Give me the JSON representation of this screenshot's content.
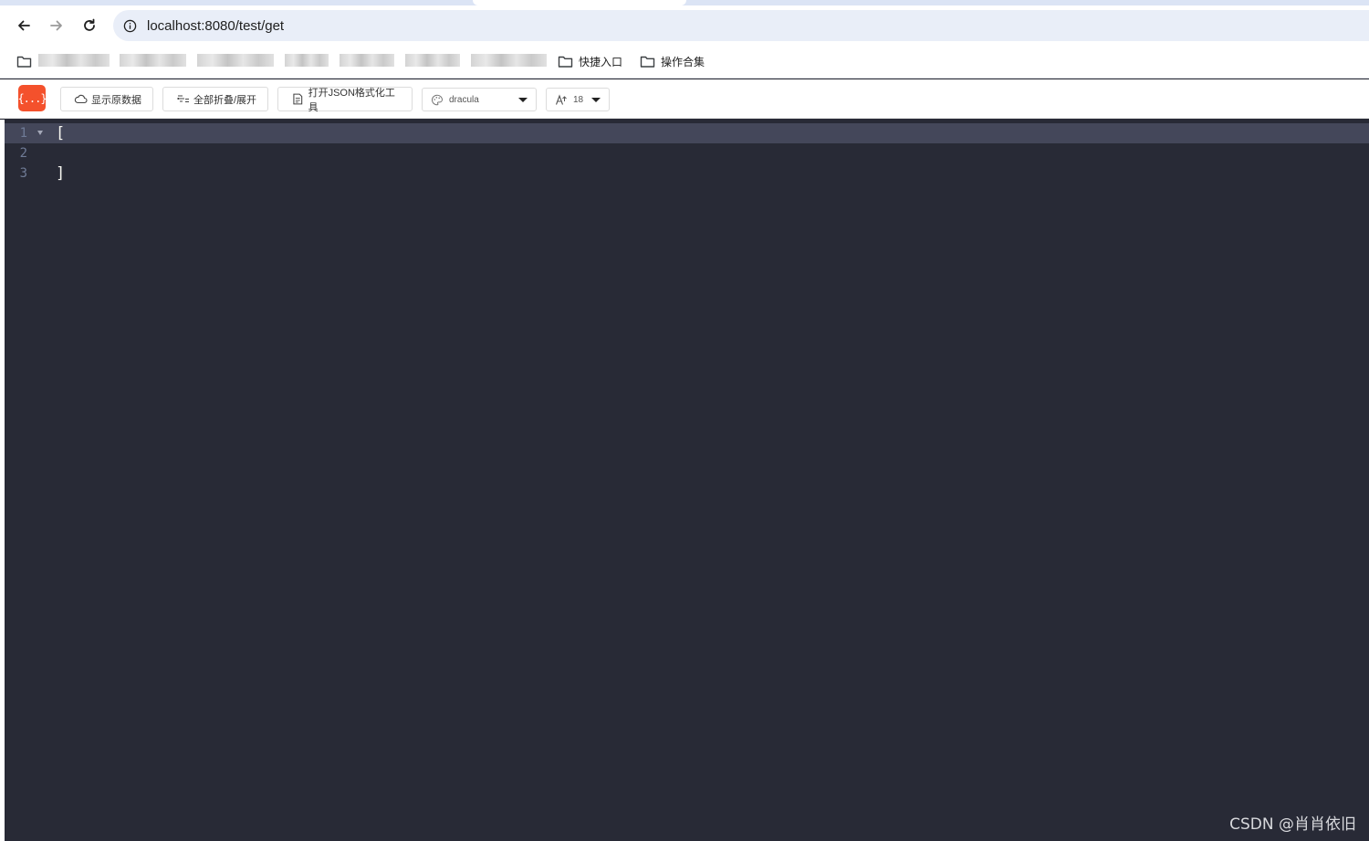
{
  "browser": {
    "url": "localhost:8080/test/get"
  },
  "bookmarks": {
    "folders": [
      {
        "label": "快捷入口"
      },
      {
        "label": "操作合集"
      }
    ]
  },
  "toolbar": {
    "logo_text": "{...}",
    "show_raw_label": "显示原数据",
    "collapse_expand_label": "全部折叠/展开",
    "open_json_tool_label": "打开JSON格式化工具",
    "theme_value": "dracula",
    "font_size_value": "18"
  },
  "editor": {
    "lines": [
      {
        "number": "1",
        "text": "["
      },
      {
        "number": "2",
        "text": ""
      },
      {
        "number": "3",
        "text": "]"
      }
    ],
    "colors": {
      "background": "#282a36",
      "active_line": "#44475a",
      "text": "#f8f8f2"
    }
  },
  "watermark": {
    "text": "CSDN @肖肖依旧"
  }
}
